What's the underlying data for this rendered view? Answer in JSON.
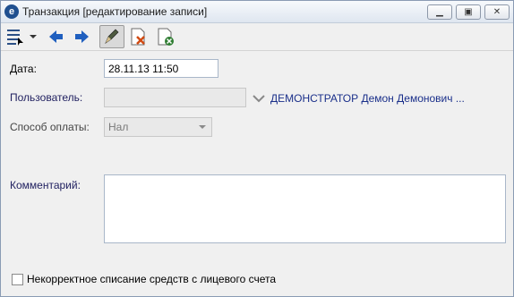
{
  "window": {
    "title": "Транзакция [редактирование записи]",
    "app_icon": "app-logo-icon",
    "controls": {
      "minimize": "minimize-icon",
      "maximize": "maximize-icon",
      "close": "close-icon"
    }
  },
  "toolbar": {
    "items": [
      "view-list-icon",
      "dropdown-arrow-icon",
      "back-arrow-icon",
      "forward-arrow-icon",
      "edit-pen-icon",
      "delete-doc-icon",
      "cancel-doc-icon"
    ],
    "active_item": "edit-pen-icon"
  },
  "form": {
    "date_label": "Дата:",
    "date_value": "28.11.13 11:50",
    "user_label": "Пользователь:",
    "user_value": "ДЕМОНСТРАТОР Демон Демонович ...",
    "payment_label": "Способ оплаты:",
    "payment_value": "Нал",
    "comment_label": "Комментарий:",
    "comment_value": "",
    "incorrect_label": "Некорректное списание средств с лицевого счета",
    "incorrect_checked": false
  },
  "colors": {
    "titlebar": "#dfe6f0",
    "link": "#1a2f8a",
    "arrows": "#1f5fbf"
  }
}
